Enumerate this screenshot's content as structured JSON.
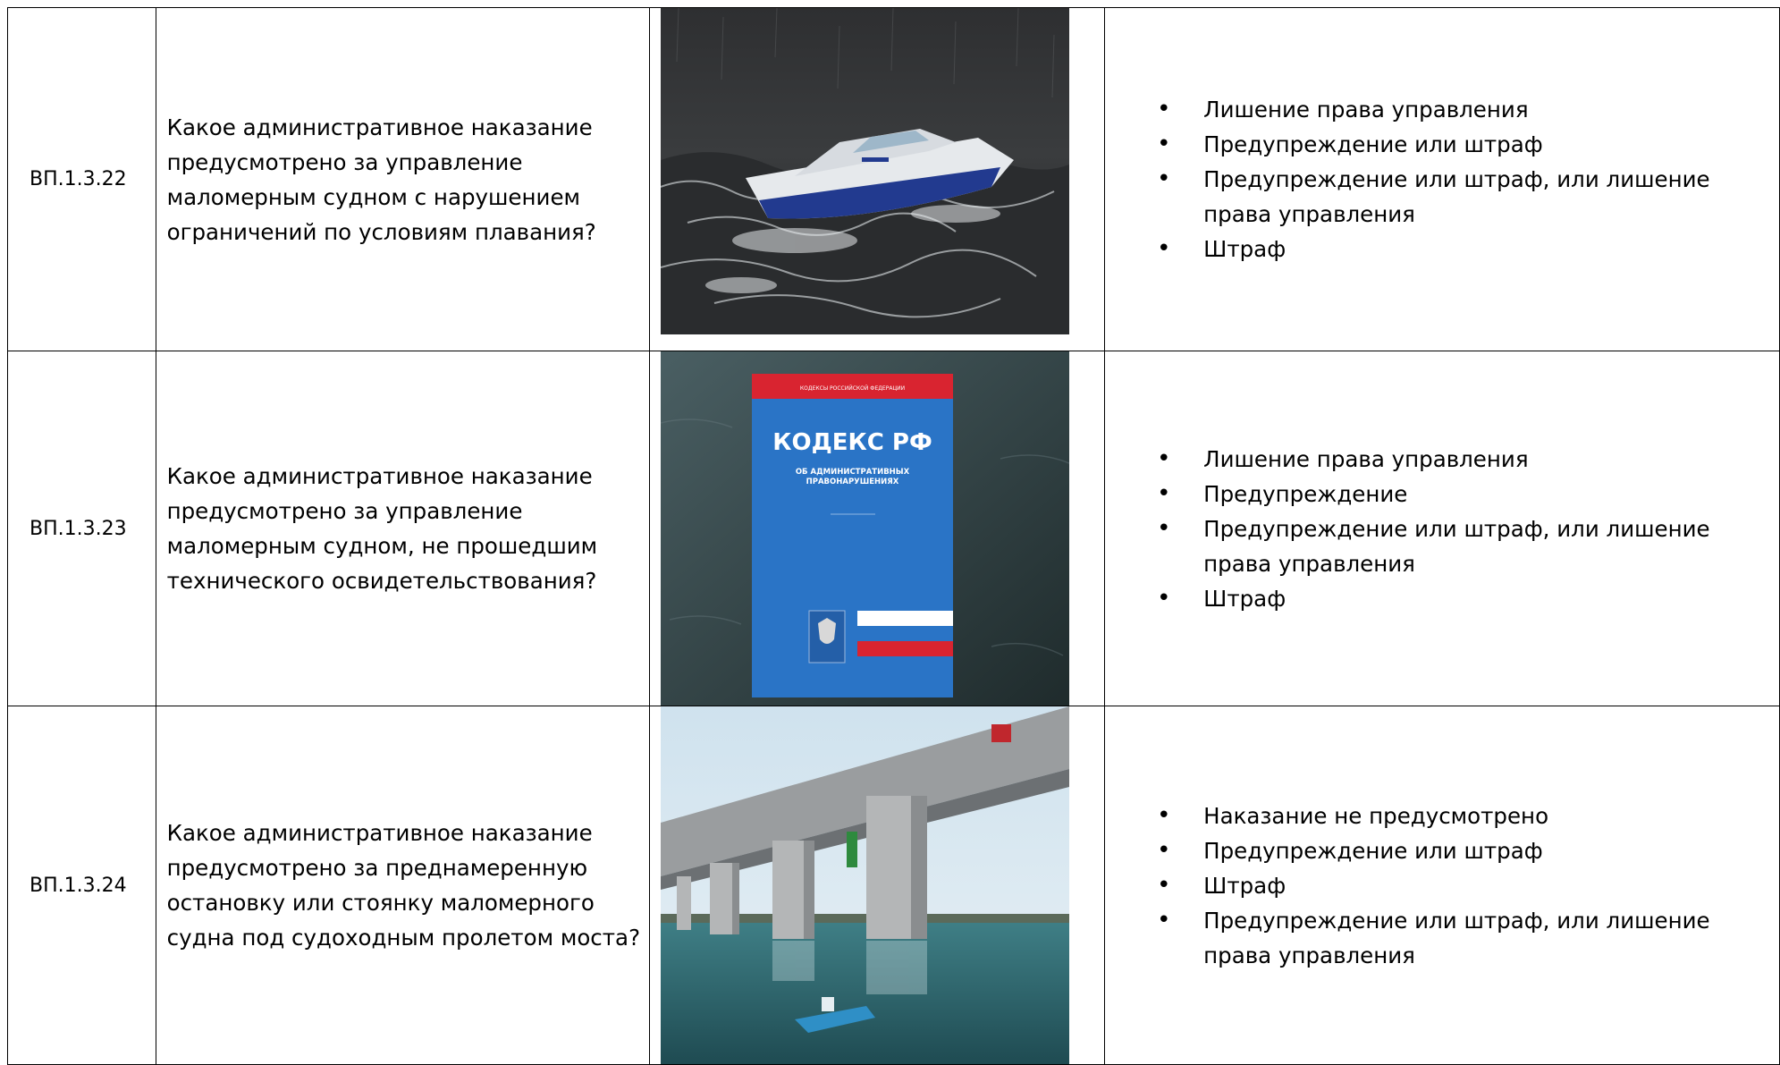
{
  "rows": [
    {
      "id": "ВП.1.3.22",
      "question": "Какое административное наказание предусмотрено за управление маломерным судном с нарушением ограничений по условиям плавания?",
      "image": "boat-in-storm-icon",
      "answers": [
        "Лишение права управления",
        "Предупреждение или штраф",
        "Предупреждение или штраф, или лишение права управления",
        "Штраф"
      ]
    },
    {
      "id": "ВП.1.3.23",
      "question": "Какое административное наказание предусмотрено за управление маломерным судном, не прошедшим технического освидетельствования?",
      "image": "administrative-code-book-icon",
      "book": {
        "top_band": "КОДЕКСЫ РОССИЙСКОЙ ФЕДЕРАЦИИ",
        "title": "КОДЕКС РФ",
        "subtitle_1": "ОБ АДМИНИСТРАТИВНЫХ",
        "subtitle_2": "ПРАВОНАРУШЕНИЯХ"
      },
      "answers": [
        "Лишение права управления",
        "Предупреждение",
        "Предупреждение или штраф, или лишение права управления",
        "Штраф"
      ]
    },
    {
      "id": "ВП.1.3.24",
      "question": "Какое административное наказание предусмотрено за преднамеренную остановку или стоянку маломерного судна под судоходным пролетом моста?",
      "image": "boat-under-bridge-icon",
      "answers": [
        "Наказание не предусмотрено",
        "Предупреждение или штраф",
        "Штраф",
        "Предупреждение или штраф, или лишение права управления"
      ]
    }
  ],
  "colors": {
    "border": "#000000",
    "book_blue": "#2a74c6",
    "book_red": "#d92430",
    "water_dark": "#2b3b3a"
  }
}
